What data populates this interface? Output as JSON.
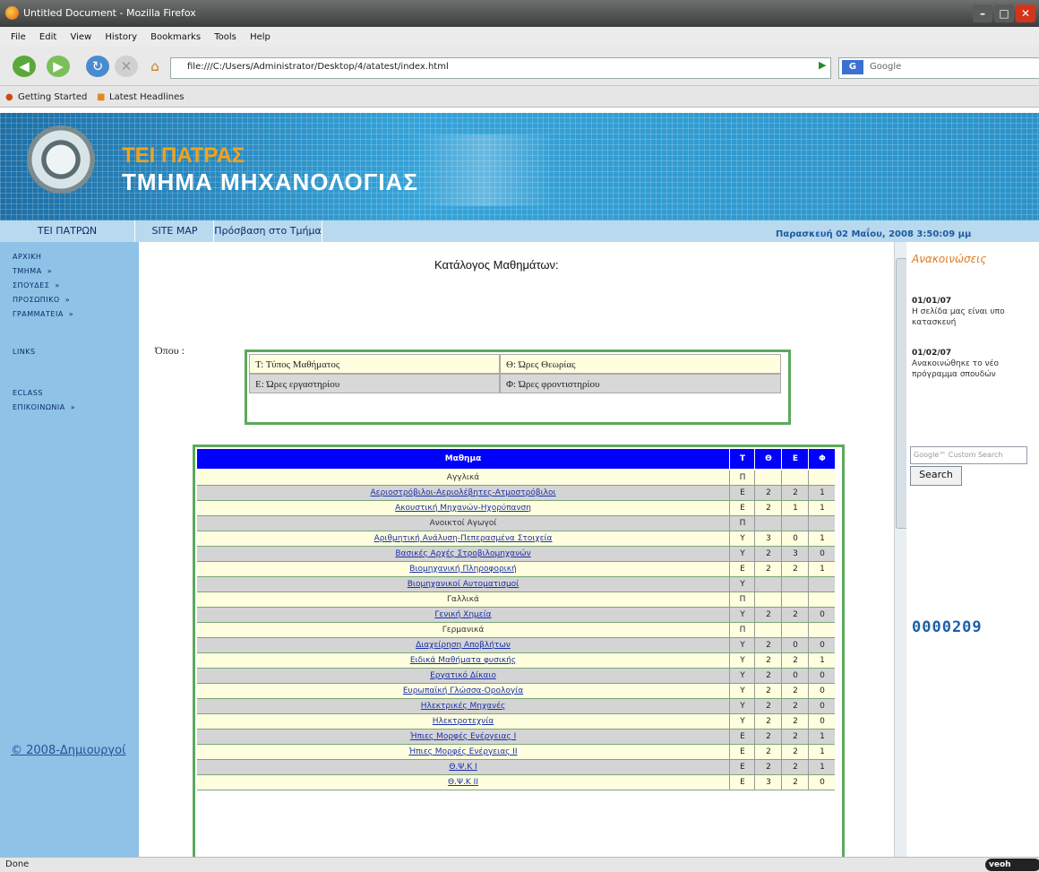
{
  "window": {
    "title": "Untitled Document - Mozilla Firefox"
  },
  "menu": [
    "File",
    "Edit",
    "View",
    "History",
    "Bookmarks",
    "Tools",
    "Help"
  ],
  "url": "file:///C:/Users/Administrator/Desktop/4/atatest/index.html",
  "search_engine": "Google",
  "bookmarks": [
    "Getting Started",
    "Latest Headlines"
  ],
  "banner": {
    "line1": "TEI ΠΑΤΡΑΣ",
    "line2": "ΤΜΗΜΑ ΜΗΧΑΝΟΛΟΓΙΑΣ"
  },
  "topnav": [
    "TEI ΠΑΤΡΩΝ",
    "SITE MAP",
    "Πρόσβαση στο Τμήμα"
  ],
  "datetime": "Παρασκευή 02 Μαΐου, 2008 3:50:09 μμ",
  "sidebar": [
    {
      "label": "ΑΡΧΙΚΗ",
      "arrow": ""
    },
    {
      "label": "ΤΜΗΜΑ",
      "arrow": "»"
    },
    {
      "label": "ΣΠΟΥΔΕΣ",
      "arrow": "»"
    },
    {
      "label": "ΠΡΟΣΩΠΙΚΟ",
      "arrow": "»"
    },
    {
      "label": "ΓΡΑΜΜΑΤΕΙΑ",
      "arrow": "»"
    },
    {
      "label": "LINKS",
      "arrow": ""
    },
    {
      "label": "ECLASS",
      "arrow": ""
    },
    {
      "label": "ΕΠΙΚΟΙΝΩΝΙΑ",
      "arrow": "»"
    }
  ],
  "copyright": "© 2008-Δημιουργοί",
  "content": {
    "title": "Κατάλογος Μαθημάτων:",
    "where": "Όπου :",
    "legend": [
      "Τ: Τύπος Μαθήματος",
      "Θ: Ώρες Θεωρίας",
      "Ε: Ώρες εργαστηρίου",
      "Φ: Ώρες φροντιστηρίου"
    ],
    "headers": [
      "Μαθημα",
      "Τ",
      "Θ",
      "Ε",
      "Φ"
    ],
    "rows": [
      {
        "name": "Αγγλικά",
        "t": "Π",
        "th": "",
        "e": "",
        "f": "",
        "link": false
      },
      {
        "name": "Αεριοστρόβιλοι-Αεριολέβητες-Ατμοστρόβιλοι",
        "t": "Ε",
        "th": "2",
        "e": "2",
        "f": "1",
        "link": true
      },
      {
        "name": "Ακουστική Μηχανών-Ηχορύπανση",
        "t": "Ε",
        "th": "2",
        "e": "1",
        "f": "1",
        "link": true
      },
      {
        "name": "Ανοικτοί Αγωγοί",
        "t": "Π",
        "th": "",
        "e": "",
        "f": "",
        "link": false
      },
      {
        "name": "Αριθμητική Ανάλυση-Πεπερασμένα Στοιχεία",
        "t": "Υ",
        "th": "3",
        "e": "0",
        "f": "1",
        "link": true
      },
      {
        "name": "Βασικές Αρχές Στροβιλομηχανών",
        "t": "Υ",
        "th": "2",
        "e": "3",
        "f": "0",
        "link": true
      },
      {
        "name": "Βιομηχανική Πληροφορική",
        "t": "Ε",
        "th": "2",
        "e": "2",
        "f": "1",
        "link": true
      },
      {
        "name": "Βιομηχανικοί Αυτοματισμοί",
        "t": "Υ",
        "th": "",
        "e": "",
        "f": "",
        "link": true
      },
      {
        "name": "Γαλλικά",
        "t": "Π",
        "th": "",
        "e": "",
        "f": "",
        "link": false
      },
      {
        "name": "Γενική Χημεία",
        "t": "Υ",
        "th": "2",
        "e": "2",
        "f": "0",
        "link": true
      },
      {
        "name": "Γερμανικά",
        "t": "Π",
        "th": "",
        "e": "",
        "f": "",
        "link": false
      },
      {
        "name": "Διαχείρηση Αποβλήτων",
        "t": "Υ",
        "th": "2",
        "e": "0",
        "f": "0",
        "link": true
      },
      {
        "name": "Ειδικά Μαθήματα φυσικής",
        "t": "Υ",
        "th": "2",
        "e": "2",
        "f": "1",
        "link": true
      },
      {
        "name": "Εργατικό Δίκαιο",
        "t": "Υ",
        "th": "2",
        "e": "0",
        "f": "0",
        "link": true
      },
      {
        "name": "Ευρωπαϊκή Γλώσσα-Ορολογία",
        "t": "Υ",
        "th": "2",
        "e": "2",
        "f": "0",
        "link": true
      },
      {
        "name": "Ηλεκτρικές Μηχανές",
        "t": "Υ",
        "th": "2",
        "e": "2",
        "f": "0",
        "link": true
      },
      {
        "name": "Ηλεκτροτεχνία",
        "t": "Υ",
        "th": "2",
        "e": "2",
        "f": "0",
        "link": true
      },
      {
        "name": "Ήπιες Μορφές Ενέργειας I",
        "t": "Ε",
        "th": "2",
        "e": "2",
        "f": "1",
        "link": true
      },
      {
        "name": "Ήπιες Μορφές Ενέργειας II",
        "t": "Ε",
        "th": "2",
        "e": "2",
        "f": "1",
        "link": true
      },
      {
        "name": "Θ.Ψ.Κ I",
        "t": "Ε",
        "th": "2",
        "e": "2",
        "f": "1",
        "link": true
      },
      {
        "name": "Θ.Ψ.Κ II",
        "t": "Ε",
        "th": "3",
        "e": "2",
        "f": "0",
        "link": true
      }
    ]
  },
  "announcements": {
    "title": "Ανακοινώσεις",
    "items": [
      {
        "date": "01/01/07",
        "text": "Η σελίδα μας είναι υπο κατασκευή"
      },
      {
        "date": "01/02/07",
        "text": "Ανακοινώθηκε το νέο πρόγραμμα σπουδών"
      }
    ],
    "search_placeholder": "Google™ Custom Search",
    "search_button": "Search",
    "counter": "0000209"
  },
  "status": {
    "text": "Done",
    "badge": "veoh"
  }
}
